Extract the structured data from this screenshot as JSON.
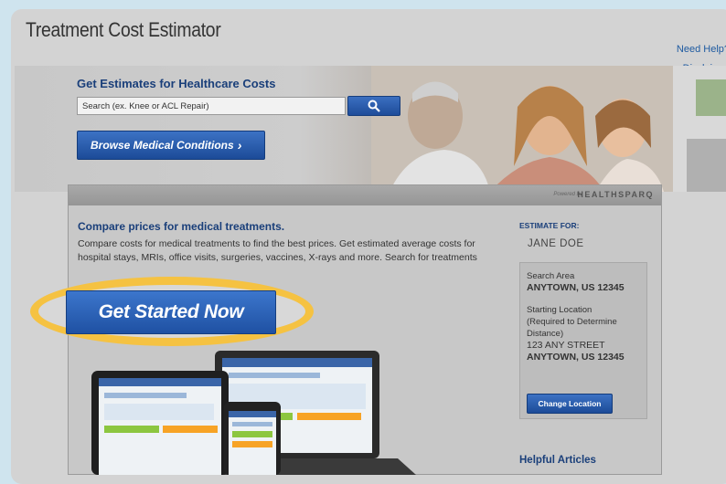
{
  "window": {
    "title": "Treatment Cost Estimator"
  },
  "links": {
    "need_help": "Need Help?",
    "disclaimer": "Disclaimer"
  },
  "hero": {
    "heading": "Get Estimates for Healthcare Costs",
    "search_placeholder": "Search (ex. Knee or ACL Repair)",
    "browse_label": "Browse Medical Conditions",
    "browse_arrow": "›"
  },
  "panel": {
    "powered_by": "Powered by",
    "brand": "HEALTHSPARQ",
    "compare_title": "Compare prices for medical treatments.",
    "compare_text": "Compare costs for medical treatments to find the best prices. Get estimated average costs for hospital stays, MRIs, office visits, surgeries, vaccines, X-rays and more. Search for treatments",
    "cta_label": "Get Started Now"
  },
  "sidebar": {
    "estimate_for": "ESTIMATE FOR:",
    "user_name": "JANE DOE",
    "search_area_label": "Search Area",
    "search_area_value": "ANYTOWN, US 12345",
    "starting_location_label": "Starting Location",
    "starting_location_note": "(Required to Determine Distance)",
    "address_line1": "123 ANY STREET",
    "address_line2": "ANYTOWN, US 12345",
    "change_location_label": "Change Location",
    "helpful_articles": "Helpful Articles"
  },
  "colors": {
    "accent": "#1f51a3",
    "highlight": "#f5c242",
    "heading": "#1a3f7a"
  }
}
